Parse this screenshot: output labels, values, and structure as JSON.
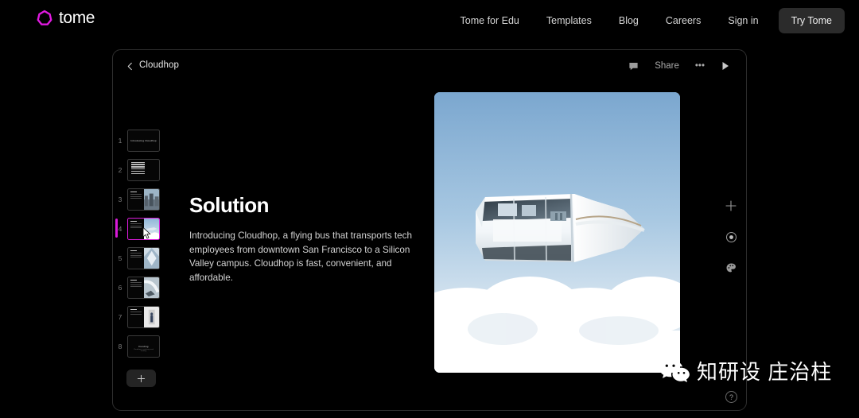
{
  "site": {
    "brand": "tome",
    "logo_color": "#e01ae0",
    "nav_links": [
      {
        "label": "Tome for Edu"
      },
      {
        "label": "Templates"
      },
      {
        "label": "Blog"
      },
      {
        "label": "Careers"
      },
      {
        "label": "Sign in"
      }
    ],
    "cta_label": "Try Tome"
  },
  "app": {
    "topbar": {
      "back_icon": "chevron-left-icon",
      "deck_title": "Cloudhop",
      "comment_icon": "comment-bubble-icon",
      "share_label": "Share",
      "more_label": "•••",
      "play_icon": "play-icon"
    },
    "rail": {
      "add_slide_label": "+",
      "selected_index": 4,
      "accent_color": "#d81ad8",
      "slides": [
        {
          "num": "1",
          "kind": "title",
          "title": "Introducing Cloudhop",
          "subtitle": ""
        },
        {
          "num": "2",
          "kind": "list",
          "title": ""
        },
        {
          "num": "3",
          "kind": "text-image",
          "title": "Problem"
        },
        {
          "num": "4",
          "kind": "text-image",
          "title": "Solution"
        },
        {
          "num": "5",
          "kind": "text-image",
          "title": "Features"
        },
        {
          "num": "6",
          "kind": "text-image",
          "title": "Benefits"
        },
        {
          "num": "7",
          "kind": "text-image",
          "title": "Pricing"
        },
        {
          "num": "8",
          "kind": "title",
          "title": "Funding",
          "subtitle": "Cloudhop is seeking seed funding"
        }
      ]
    },
    "slide": {
      "title": "Solution",
      "body": "Introducing Cloudhop, a flying bus that transports tech employees from downtown San Francisco to a Silicon Valley campus. Cloudhop is fast, convenient, and affordable.",
      "image_alt": "Futuristic flying bus above clouds"
    },
    "tools": [
      {
        "icon": "plus-icon",
        "name": "add-block-button"
      },
      {
        "icon": "target-circle-icon",
        "name": "theme-button"
      },
      {
        "icon": "palette-icon",
        "name": "palette-button"
      }
    ],
    "help_label": "?"
  },
  "watermark": {
    "icon": "wechat-icon",
    "text": "知研设 庄治柱"
  }
}
